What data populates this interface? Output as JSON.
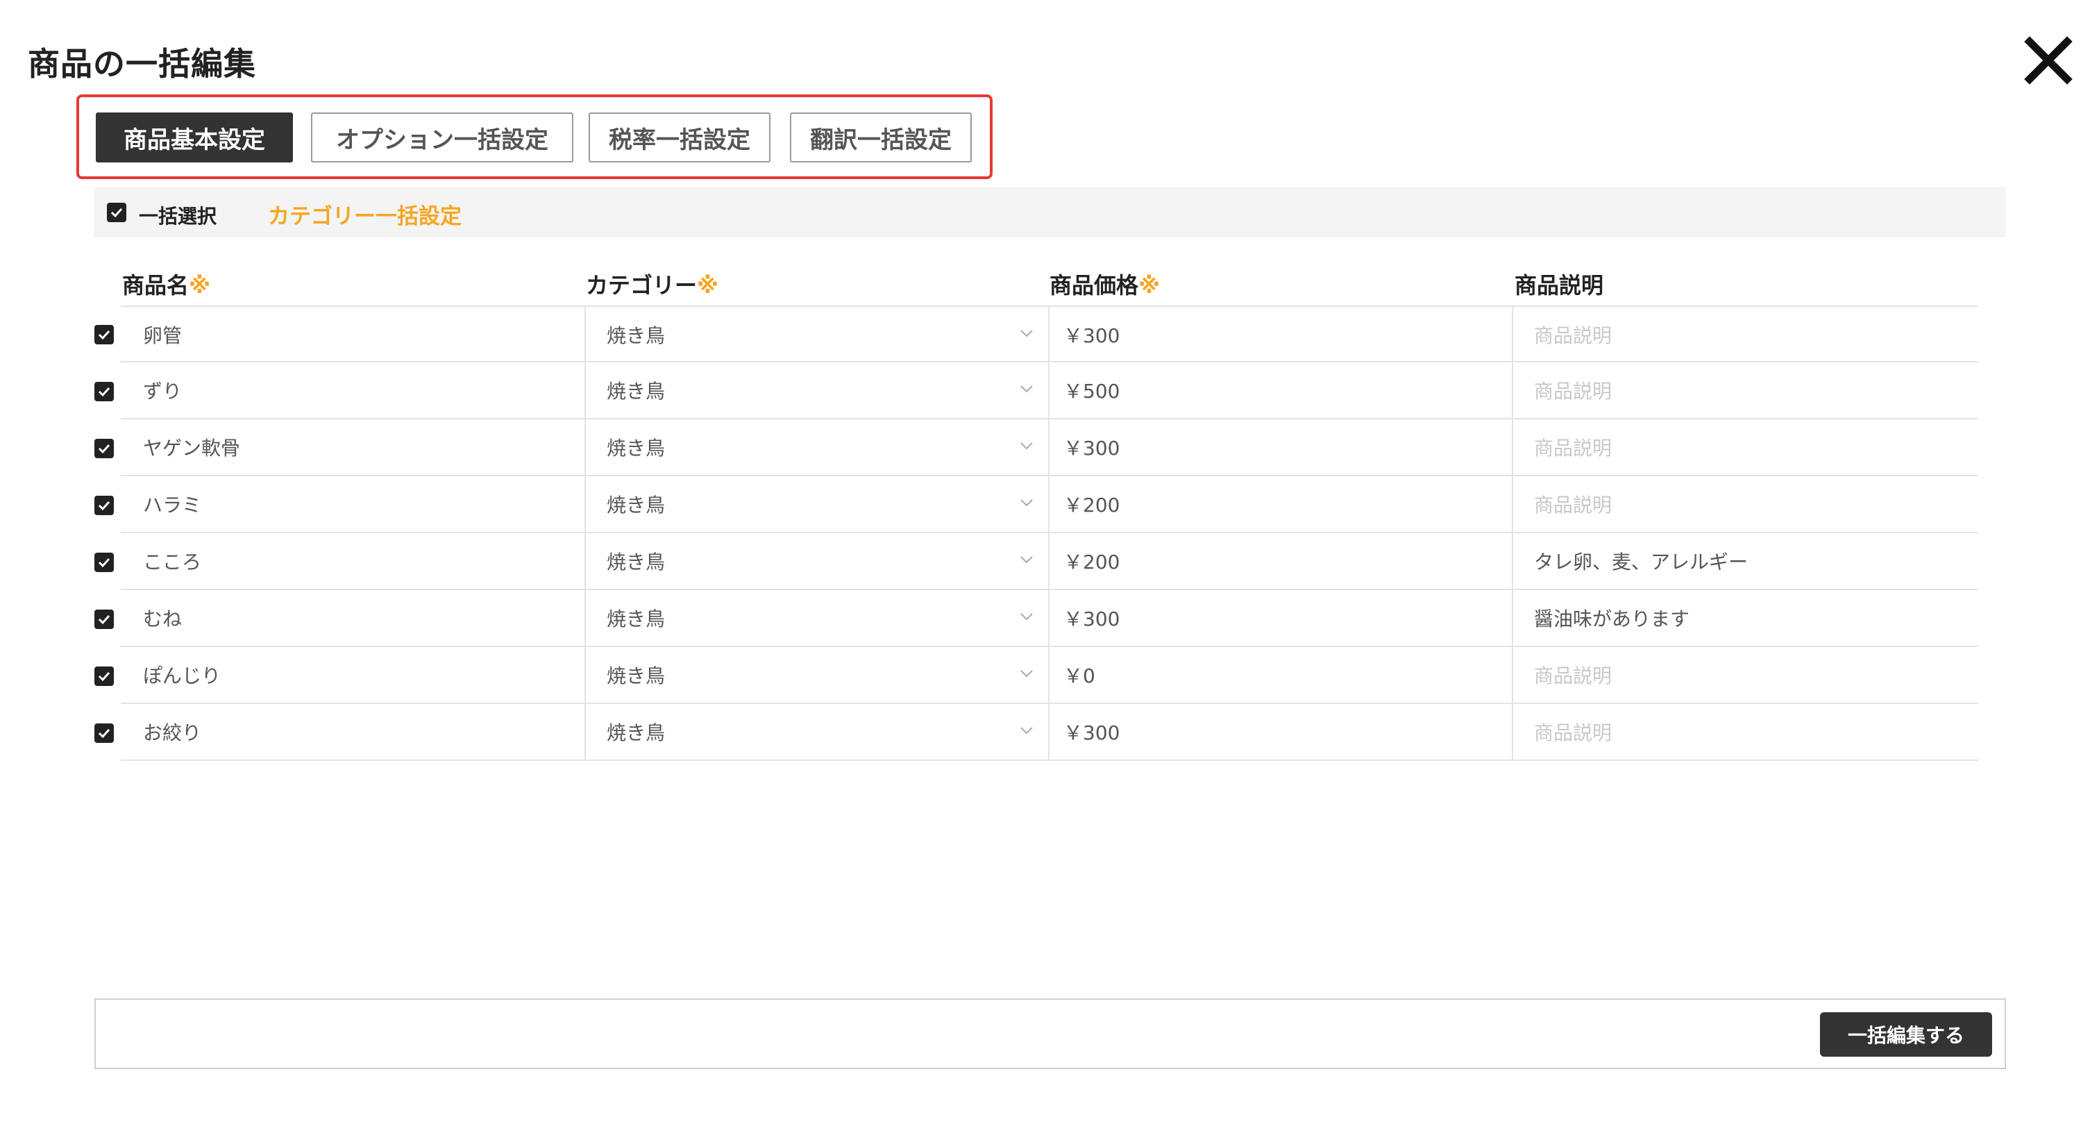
{
  "dialog": {
    "title": "商品の一括編集"
  },
  "tabs": [
    {
      "label": "商品基本設定",
      "active": true
    },
    {
      "label": "オプション一括設定",
      "active": false
    },
    {
      "label": "税率一括設定",
      "active": false
    },
    {
      "label": "翻訳一括設定",
      "active": false
    }
  ],
  "select_bar": {
    "select_all_label": "一括選択",
    "select_all_checked": true,
    "category_bulk_link": "カテゴリー一括設定"
  },
  "columns": {
    "name": "商品名",
    "category": "カテゴリー",
    "price": "商品価格",
    "description": "商品説明",
    "required_mark": "※"
  },
  "description_placeholder": "商品説明",
  "rows": [
    {
      "checked": true,
      "name": "卵管",
      "category": "焼き鳥",
      "price": "￥300",
      "description": ""
    },
    {
      "checked": true,
      "name": "ずり",
      "category": "焼き鳥",
      "price": "￥500",
      "description": ""
    },
    {
      "checked": true,
      "name": "ヤゲン軟骨",
      "category": "焼き鳥",
      "price": "￥300",
      "description": ""
    },
    {
      "checked": true,
      "name": "ハラミ",
      "category": "焼き鳥",
      "price": "￥200",
      "description": ""
    },
    {
      "checked": true,
      "name": "こころ",
      "category": "焼き鳥",
      "price": "￥200",
      "description": "タレ卵、麦、アレルギー"
    },
    {
      "checked": true,
      "name": "むね",
      "category": "焼き鳥",
      "price": "￥300",
      "description": "醤油味があります"
    },
    {
      "checked": true,
      "name": "ぽんじり",
      "category": "焼き鳥",
      "price": "￥0",
      "description": ""
    },
    {
      "checked": true,
      "name": "お絞り",
      "category": "焼き鳥",
      "price": "￥300",
      "description": ""
    }
  ],
  "footer": {
    "bulk_edit_button": "一括編集する"
  },
  "colors": {
    "accent": "#f5a623",
    "highlight_border": "#e53935",
    "active_tab": "#333333"
  },
  "icons": {
    "close": "close-icon",
    "checkbox": "checkmark-icon",
    "dropdown": "chevron-down-icon"
  }
}
